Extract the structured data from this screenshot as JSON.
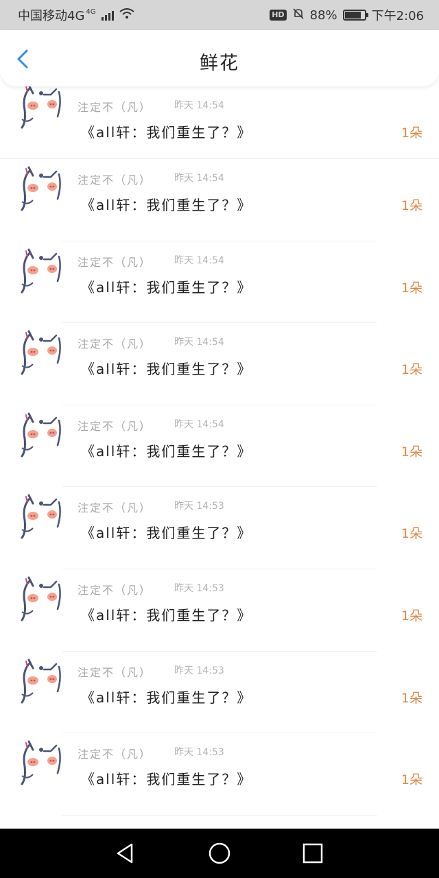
{
  "status_bar": {
    "carrier": "中国移动4G",
    "network_badge": "4G",
    "hd_label": "HD",
    "battery": "88%",
    "battery_level": 0.88,
    "time": "下午2:06"
  },
  "header": {
    "title": "鲜花",
    "back_icon": "chevron-left-icon",
    "accent_color": "#2f8fe6"
  },
  "items": [
    {
      "name": "注定不（凡）",
      "time": "昨天 14:54",
      "title": "《all轩：我们重生了？》",
      "count": "1朵"
    },
    {
      "name": "注定不（凡）",
      "time": "昨天 14:54",
      "title": "《all轩：我们重生了？》",
      "count": "1朵"
    },
    {
      "name": "注定不（凡）",
      "time": "昨天 14:54",
      "title": "《all轩：我们重生了？》",
      "count": "1朵"
    },
    {
      "name": "注定不（凡）",
      "time": "昨天 14:54",
      "title": "《all轩：我们重生了？》",
      "count": "1朵"
    },
    {
      "name": "注定不（凡）",
      "time": "昨天 14:54",
      "title": "《all轩：我们重生了？》",
      "count": "1朵"
    },
    {
      "name": "注定不（凡）",
      "time": "昨天 14:53",
      "title": "《all轩：我们重生了？》",
      "count": "1朵"
    },
    {
      "name": "注定不（凡）",
      "time": "昨天 14:53",
      "title": "《all轩：我们重生了？》",
      "count": "1朵"
    },
    {
      "name": "注定不（凡）",
      "time": "昨天 14:53",
      "title": "《all轩：我们重生了？》",
      "count": "1朵"
    },
    {
      "name": "注定不（凡）",
      "time": "昨天 14:53",
      "title": "《all轩：我们重生了？》",
      "count": "1朵"
    }
  ],
  "colors": {
    "count": "#e08744",
    "status_bar": "#d6d6d6",
    "nav_bar": "#000000"
  },
  "nav": {
    "back_icon": "triangle-back-icon",
    "home_icon": "circle-home-icon",
    "recents_icon": "square-recents-icon"
  }
}
